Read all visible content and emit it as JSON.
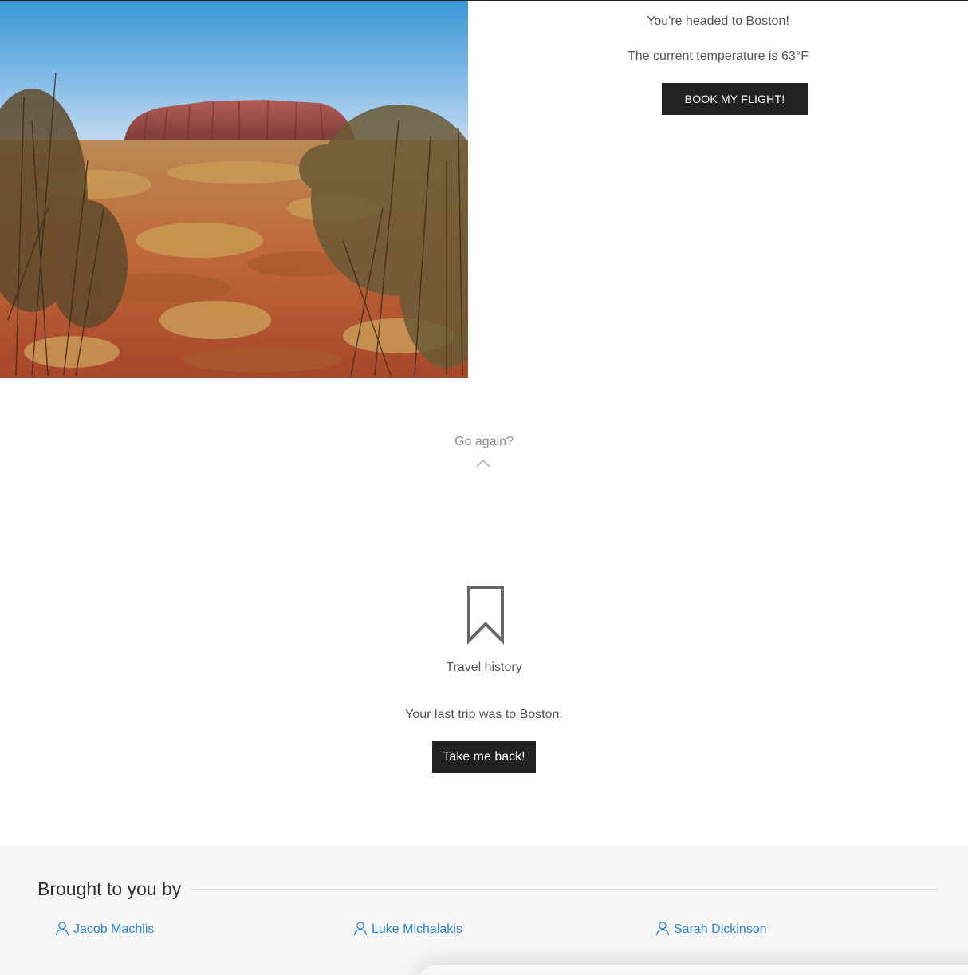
{
  "destination": {
    "headline": "You're headed to Boston!",
    "temperature": "The current temperature is 63°F",
    "book_button_label": "BOOK MY FLIGHT!"
  },
  "go_again": {
    "label": "Go again?",
    "icon": "chevron-up-icon"
  },
  "travel_history": {
    "icon": "bookmark-icon",
    "title": "Travel history",
    "last_trip": "Your last trip was to Boston.",
    "back_button_label": "Take me back!"
  },
  "footer": {
    "heading": "Brought to you by",
    "credits": [
      {
        "name": "Jacob Machlis",
        "icon": "user-icon"
      },
      {
        "name": "Luke Michalakis",
        "icon": "user-icon"
      },
      {
        "name": "Sarah Dickinson",
        "icon": "user-icon"
      }
    ]
  },
  "colors": {
    "button_bg": "#222222",
    "button_text": "#ffffff",
    "link": "#2b86d6",
    "footer_bg": "#f7f7f7",
    "muted_text": "#8a8a8a"
  }
}
